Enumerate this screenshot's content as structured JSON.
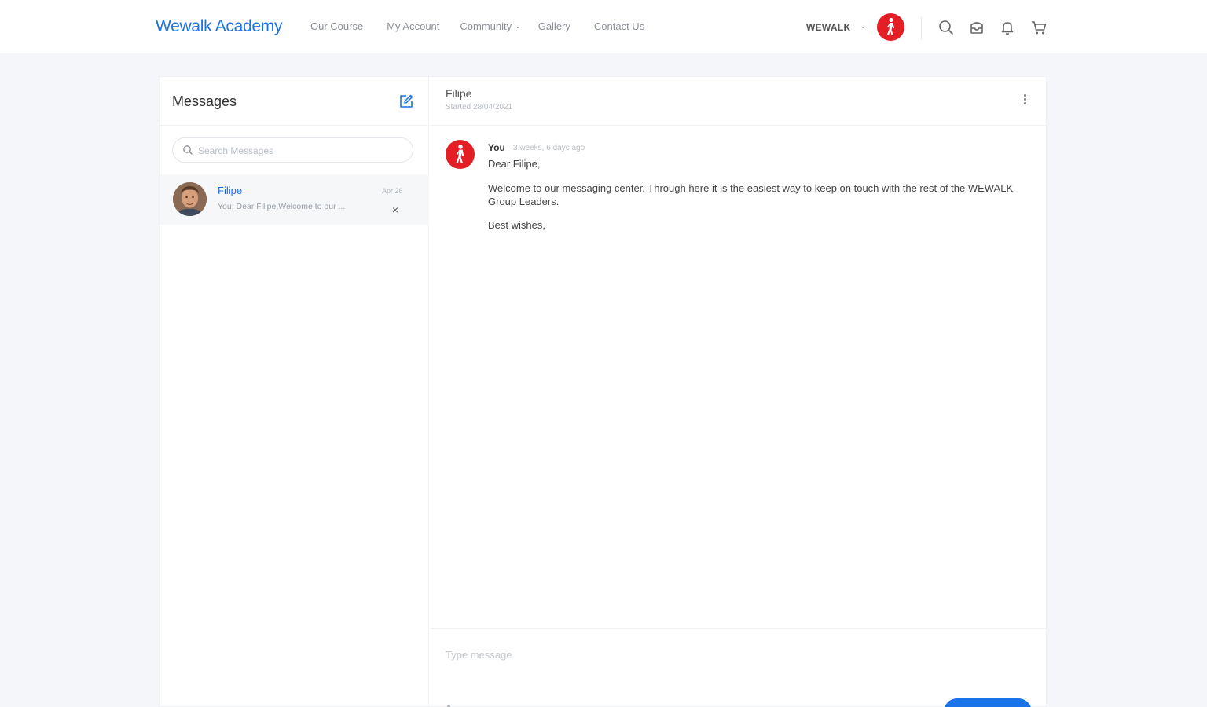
{
  "header": {
    "brand": "Wewalk Academy",
    "nav": [
      {
        "label": "Our Course",
        "has_dropdown": false
      },
      {
        "label": "My Account",
        "has_dropdown": false
      },
      {
        "label": "Community",
        "has_dropdown": true
      },
      {
        "label": "Gallery",
        "has_dropdown": false
      },
      {
        "label": "Contact Us",
        "has_dropdown": false
      }
    ],
    "user_name": "WEWALK",
    "icons": [
      "search-icon",
      "inbox-icon",
      "bell-icon",
      "cart-icon"
    ]
  },
  "messages": {
    "title": "Messages",
    "search_placeholder": "Search Messages",
    "threads": [
      {
        "name": "Filipe",
        "date": "Apr 26",
        "preview": "You: Dear Filipe,Welcome to our ..."
      }
    ]
  },
  "conversation": {
    "name": "Filipe",
    "started": "Started 28/04/2021",
    "message": {
      "author": "You",
      "time": "3 weeks, 6 days ago",
      "greeting": "Dear Filipe,",
      "body": "Welcome to our messaging center. Through here it is the easiest way to keep on touch with the rest of the WEWALK Group Leaders.",
      "closing": "Best wishes,"
    },
    "composer_placeholder": "Type message",
    "send_label": ""
  },
  "colors": {
    "accent": "#1a73e8",
    "brand_red": "#e31e24",
    "page_bg": "#f4f6f9"
  }
}
